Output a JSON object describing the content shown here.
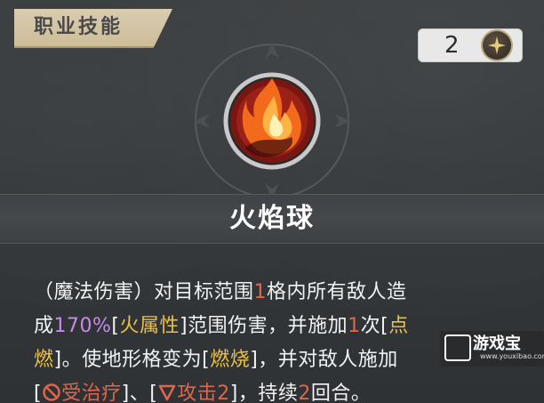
{
  "header": {
    "title": "职业技能"
  },
  "cost": {
    "value": "2",
    "icon": "star-gem-icon"
  },
  "skill": {
    "icon": "fireball-icon",
    "name": "火焰球"
  },
  "description": {
    "line1_a": "（魔法伤害）对目标范围",
    "line1_num": "1",
    "line1_b": "格内所有敌人造",
    "line2_a": "成",
    "line2_pct": "170%",
    "line2_b": "[",
    "line2_kw1": "火属性",
    "line2_c": "]范围伤害，并施加",
    "line2_num": "1",
    "line2_d": "次[",
    "line2_kw2": "点",
    "line3_kw2": "燃",
    "line3_a": "]。使地形格变为[",
    "line3_kw3": "燃烧",
    "line3_b": "]，并对敌人施加",
    "line4_a": "[",
    "line4_debuff1": "受治疗",
    "line4_b": "]、[",
    "line4_debuff2": "攻击",
    "line4_num1": "2",
    "line4_c": "]，持续",
    "line4_num2": "2",
    "line4_d": "回合。"
  },
  "watermark": {
    "name": "游戏宝",
    "url": "www.youxibao.com"
  },
  "colors": {
    "number": "#e0654b",
    "percent": "#c58be8",
    "keyword": "#e9c14a",
    "header_bg": "#d9ccb0"
  }
}
